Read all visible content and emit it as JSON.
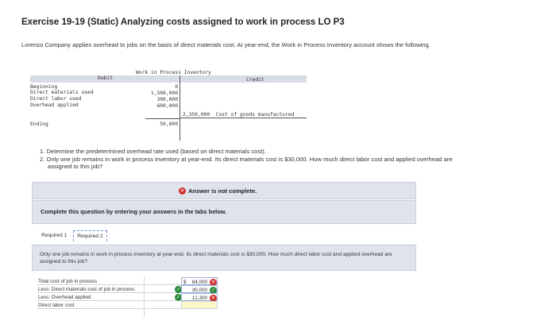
{
  "page": {
    "title": "Exercise 19-19 (Static) Analyzing costs assigned to work in process LO P3",
    "intro": "Lorenzo Company applies overhead to jobs on the basis of direct materials cost. At year-end, the Work in Process Inventory account shows the following."
  },
  "t_account": {
    "title": "Work in Process Inventory",
    "debit_header": "Debit",
    "credit_header": "Credit",
    "debit_rows": [
      {
        "label": "Beginning",
        "value": "0"
      },
      {
        "label": "Direct materials used",
        "value": "1,500,000"
      },
      {
        "label": "Direct labor used",
        "value": "300,000"
      },
      {
        "label": "Overhead applied",
        "value": "600,000"
      }
    ],
    "ending": {
      "label": "Ending",
      "value": "50,000"
    },
    "credit_row": {
      "value": "2,350,000",
      "label": "Cost of goods manufactured"
    }
  },
  "questions": {
    "q1": "1. Determine the predetermined overhead rate used (based on direct materials cost).",
    "q2": "2. Only one job remains in work in process inventory at year-end. Its direct materials cost is $30,000. How much direct labor cost and applied overhead are assigned to this job?"
  },
  "answer_status": {
    "text": "Answer is not complete.",
    "status_color": "#d0312d"
  },
  "instructions": "Complete this question by entering your answers in the tabs below.",
  "tabs": [
    {
      "label": "Required 1",
      "active": false
    },
    {
      "label": "Required 2",
      "active": true
    }
  ],
  "required2": {
    "question": "Only one job remains in work in process inventory at year-end. Its direct materials cost is $30,000. How much direct labor cost and applied overhead are assigned to this job?",
    "rows": [
      {
        "label": "Total cost of job in process",
        "dollar": "$",
        "value": "84,000",
        "status": "incorrect",
        "check": ""
      },
      {
        "label": "Less: Direct materials cost of job in process",
        "dollar": "",
        "value": "30,000",
        "status": "correct",
        "check": "correct"
      },
      {
        "label": "Less: Overhead applied",
        "dollar": "",
        "value": "12,300",
        "status": "incorrect",
        "check": "correct"
      },
      {
        "label": "Direct labor cost",
        "dollar": "",
        "value": "",
        "status": "",
        "check": ""
      }
    ]
  }
}
